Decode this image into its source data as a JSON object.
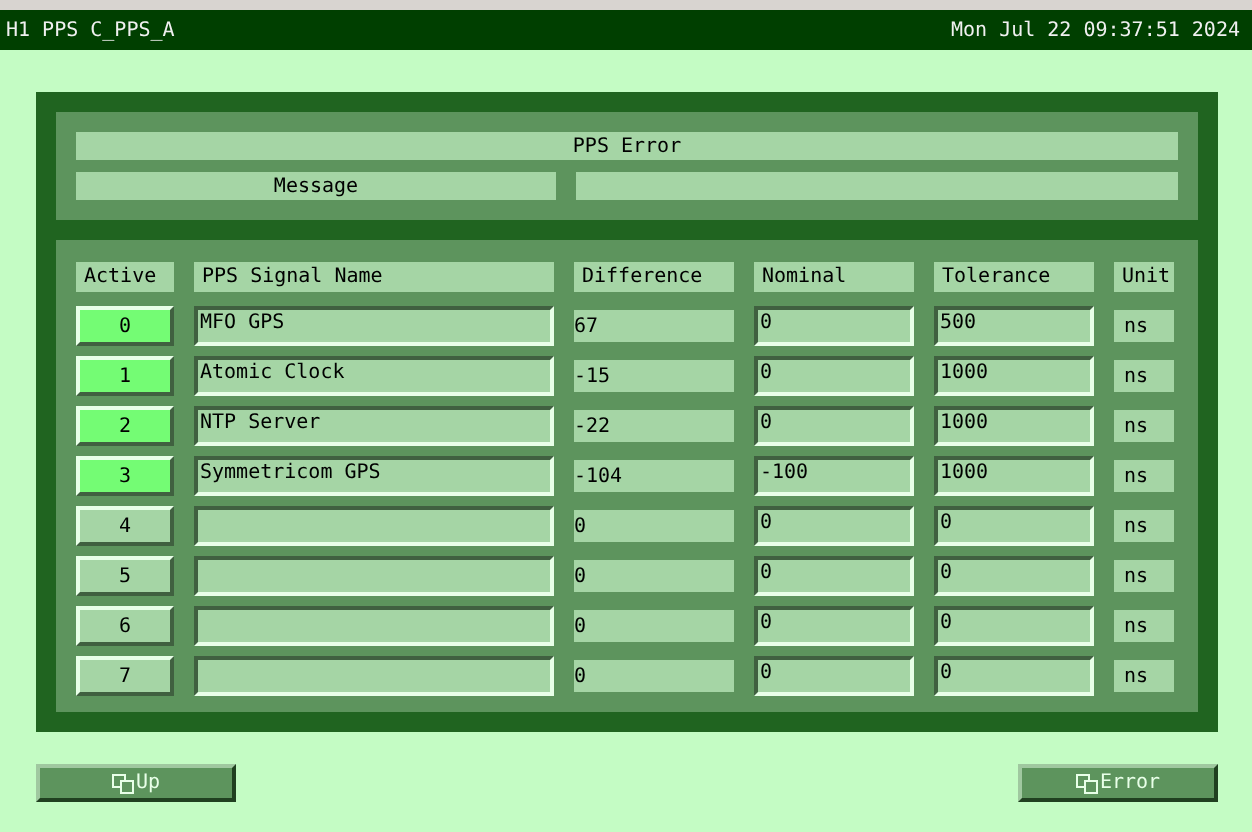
{
  "title_bar": {
    "title": "H1 PPS C_PPS_A",
    "datetime": "Mon Jul 22 09:37:51 2024"
  },
  "error_panel": {
    "title": "PPS Error",
    "message_label": "Message"
  },
  "table": {
    "columns": [
      "Active",
      "PPS Signal Name",
      "Difference",
      "Nominal",
      "Tolerance",
      "Unit"
    ],
    "rows": [
      {
        "index": "0",
        "active": true,
        "name": "MFO GPS",
        "difference": "67",
        "nominal": "0",
        "tolerance": "500",
        "unit": "ns"
      },
      {
        "index": "1",
        "active": true,
        "name": "Atomic Clock",
        "difference": "-15",
        "nominal": "0",
        "tolerance": "1000",
        "unit": "ns"
      },
      {
        "index": "2",
        "active": true,
        "name": "NTP Server",
        "difference": "-22",
        "nominal": "0",
        "tolerance": "1000",
        "unit": "ns"
      },
      {
        "index": "3",
        "active": true,
        "name": "Symmetricom GPS",
        "difference": "-104",
        "nominal": "-100",
        "tolerance": "1000",
        "unit": "ns"
      },
      {
        "index": "4",
        "active": false,
        "difference": "0",
        "nominal": "0",
        "tolerance": "0",
        "unit": "ns"
      },
      {
        "index": "5",
        "active": false,
        "difference": "0",
        "nominal": "0",
        "tolerance": "0",
        "unit": "ns"
      },
      {
        "index": "6",
        "active": false,
        "difference": "0",
        "nominal": "0",
        "tolerance": "0",
        "unit": "ns"
      },
      {
        "index": "7",
        "active": false,
        "difference": "0",
        "nominal": "0",
        "tolerance": "0",
        "unit": "ns"
      }
    ]
  },
  "buttons": [
    {
      "label": "Up"
    },
    {
      "label": "Error"
    }
  ]
}
